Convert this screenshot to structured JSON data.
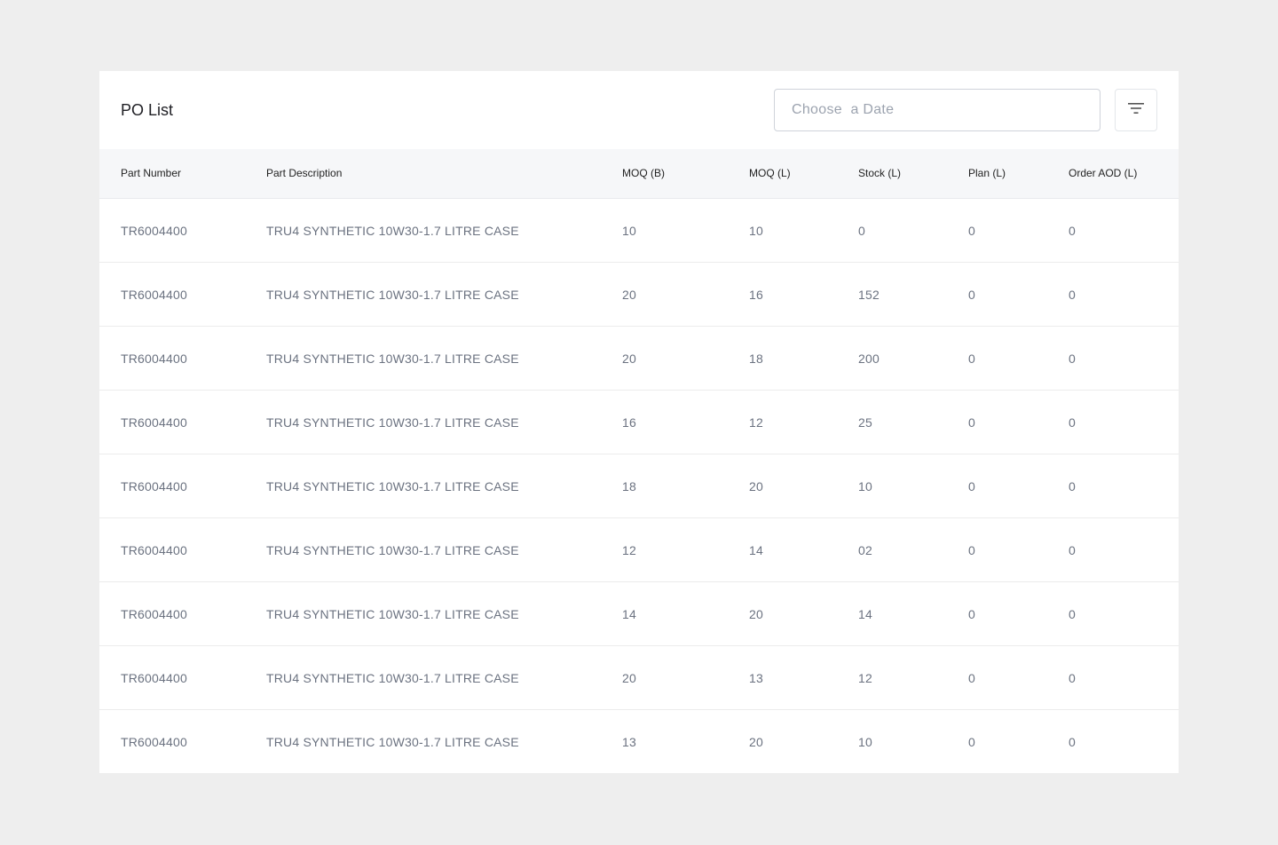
{
  "header": {
    "title": "PO List",
    "date_placeholder": "Choose  a Date"
  },
  "icons": {
    "filter": "filter-icon"
  },
  "table": {
    "columns": [
      "Part Number",
      "Part Description",
      "MOQ (B)",
      "MOQ (L)",
      "Stock (L)",
      "Plan (L)",
      "Order AOD (L)"
    ],
    "rows": [
      [
        "TR6004400",
        "TRU4 SYNTHETIC 10W30-1.7 LITRE CASE",
        "10",
        "10",
        "0",
        "0",
        "0"
      ],
      [
        "TR6004400",
        "TRU4 SYNTHETIC 10W30-1.7 LITRE CASE",
        "20",
        "16",
        "152",
        "0",
        "0"
      ],
      [
        "TR6004400",
        "TRU4 SYNTHETIC 10W30-1.7 LITRE CASE",
        "20",
        "18",
        "200",
        "0",
        "0"
      ],
      [
        "TR6004400",
        "TRU4 SYNTHETIC 10W30-1.7 LITRE CASE",
        "16",
        "12",
        "25",
        "0",
        "0"
      ],
      [
        "TR6004400",
        "TRU4 SYNTHETIC 10W30-1.7 LITRE CASE",
        "18",
        "20",
        "10",
        "0",
        "0"
      ],
      [
        "TR6004400",
        "TRU4 SYNTHETIC 10W30-1.7 LITRE CASE",
        "12",
        "14",
        "02",
        "0",
        "0"
      ],
      [
        "TR6004400",
        "TRU4 SYNTHETIC 10W30-1.7 LITRE CASE",
        "14",
        "20",
        "14",
        "0",
        "0"
      ],
      [
        "TR6004400",
        "TRU4 SYNTHETIC 10W30-1.7 LITRE CASE",
        "20",
        "13",
        "12",
        "0",
        "0"
      ],
      [
        "TR6004400",
        "TRU4 SYNTHETIC 10W30-1.7 LITRE CASE",
        "13",
        "20",
        "10",
        "0",
        "0"
      ]
    ]
  }
}
